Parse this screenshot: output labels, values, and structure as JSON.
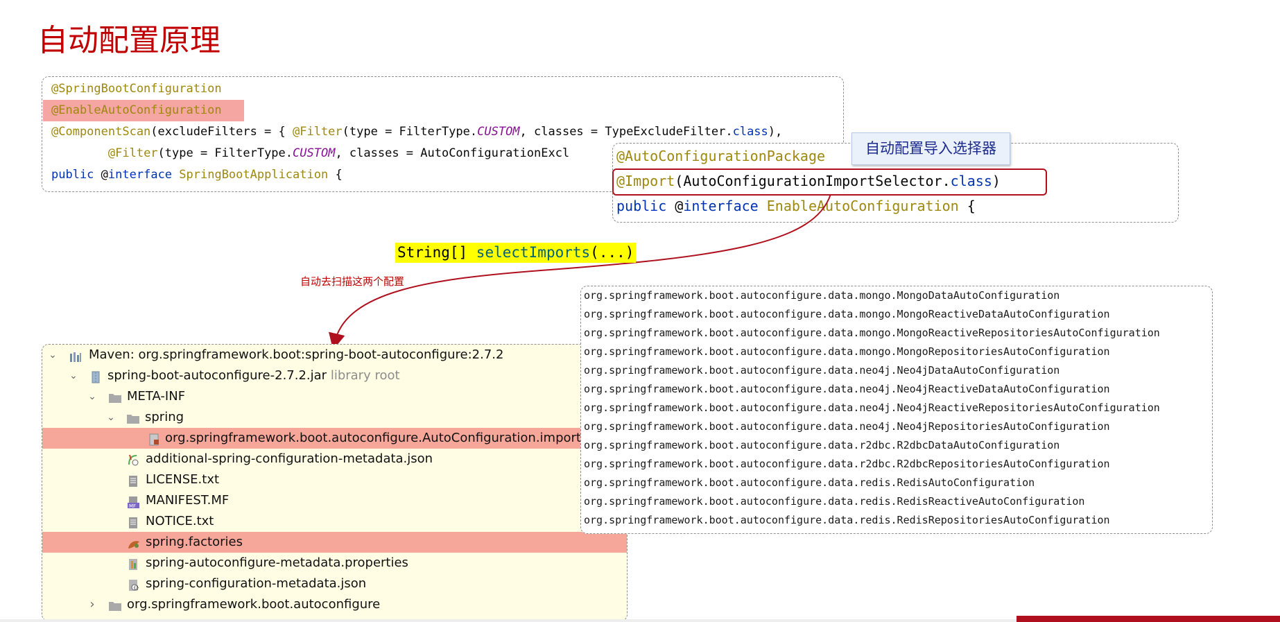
{
  "slide": {
    "title": "自动配置原理",
    "callout": "自动配置导入选择器",
    "select_imports": {
      "type": "String[] ",
      "method": "selectImports",
      "args": "(...)"
    },
    "scan_label": "自动去扫描这两个配置"
  },
  "spring_boot_application_code": {
    "line1_ann": "@SpringBootConfiguration",
    "line2_ann": "@EnableAutoConfiguration",
    "line3": {
      "ann": "@ComponentScan",
      "t1": "(excludeFilters = { ",
      "ann2": "@Filter",
      "t2": "(type = FilterType.",
      "it": "CUSTOM",
      "t3": ", classes = TypeExcludeFilter.",
      "kw": "class",
      "t4": "),"
    },
    "line4": {
      "indent": "        ",
      "ann": "@Filter",
      "t1": "(type = FilterType.",
      "it": "CUSTOM",
      "t2": ", classes = AutoConfigurationExcl"
    },
    "line5": {
      "kw": "public",
      "sp": " ",
      "at": "@",
      "kw2": "interface",
      "cls": " SpringBootApplication",
      "t": " {"
    }
  },
  "enable_auto_configuration_code": {
    "line1_ann": "@AutoConfigurationPackage",
    "line2": {
      "ann": "@Import",
      "t1": "(AutoConfigurationImportSelector.",
      "kw": "class",
      "t2": ")"
    },
    "line3": {
      "kw": "public",
      "sp": " ",
      "at": "@",
      "kw2": "interface",
      "cls": " EnableAutoConfiguration",
      "t": " {"
    }
  },
  "project_tree": {
    "items": [
      {
        "label": "Maven: org.springframework.boot:spring-boot-autoconfigure:2.7.2",
        "icon": "maven-library-icon",
        "arrow": "⌄"
      },
      {
        "label": "spring-boot-autoconfigure-2.7.2.jar",
        "note": "library root",
        "icon": "jar-icon",
        "arrow": "⌄"
      },
      {
        "label": "META-INF",
        "icon": "folder-icon",
        "arrow": "⌄"
      },
      {
        "label": "spring",
        "icon": "folder-icon",
        "arrow": "⌄"
      },
      {
        "label": "org.springframework.boot.autoconfigure.AutoConfiguration.imports",
        "icon": "imports-file-icon"
      },
      {
        "label": "additional-spring-configuration-metadata.json",
        "icon": "json-file-icon"
      },
      {
        "label": "LICENSE.txt",
        "icon": "text-file-icon"
      },
      {
        "label": "MANIFEST.MF",
        "icon": "manifest-file-icon"
      },
      {
        "label": "NOTICE.txt",
        "icon": "text-file-icon"
      },
      {
        "label": "spring.factories",
        "icon": "factories-file-icon"
      },
      {
        "label": "spring-autoconfigure-metadata.properties",
        "icon": "properties-file-icon"
      },
      {
        "label": "spring-configuration-metadata.json",
        "icon": "json-file-icon"
      },
      {
        "label": "org.springframework.boot.autoconfigure",
        "icon": "folder-icon",
        "arrow": "›"
      }
    ]
  },
  "auto_configuration_imports": [
    "org.springframework.boot.autoconfigure.data.mongo.MongoDataAutoConfiguration",
    "org.springframework.boot.autoconfigure.data.mongo.MongoReactiveDataAutoConfiguration",
    "org.springframework.boot.autoconfigure.data.mongo.MongoReactiveRepositoriesAutoConfiguration",
    "org.springframework.boot.autoconfigure.data.mongo.MongoRepositoriesAutoConfiguration",
    "org.springframework.boot.autoconfigure.data.neo4j.Neo4jDataAutoConfiguration",
    "org.springframework.boot.autoconfigure.data.neo4j.Neo4jReactiveDataAutoConfiguration",
    "org.springframework.boot.autoconfigure.data.neo4j.Neo4jReactiveRepositoriesAutoConfiguration",
    "org.springframework.boot.autoconfigure.data.neo4j.Neo4jRepositoriesAutoConfiguration",
    "org.springframework.boot.autoconfigure.data.r2dbc.R2dbcDataAutoConfiguration",
    "org.springframework.boot.autoconfigure.data.r2dbc.R2dbcRepositoriesAutoConfiguration",
    "org.springframework.boot.autoconfigure.data.redis.RedisAutoConfiguration",
    "org.springframework.boot.autoconfigure.data.redis.RedisReactiveAutoConfiguration",
    "org.springframework.boot.autoconfigure.data.redis.RedisRepositoriesAutoConfiguration"
  ],
  "colors": {
    "title": "#c00000",
    "highlight": "#f5a5a2",
    "tree_bg": "#fffee5",
    "arrow": "#b0101e",
    "select_imports_bg": "#ffff00"
  }
}
